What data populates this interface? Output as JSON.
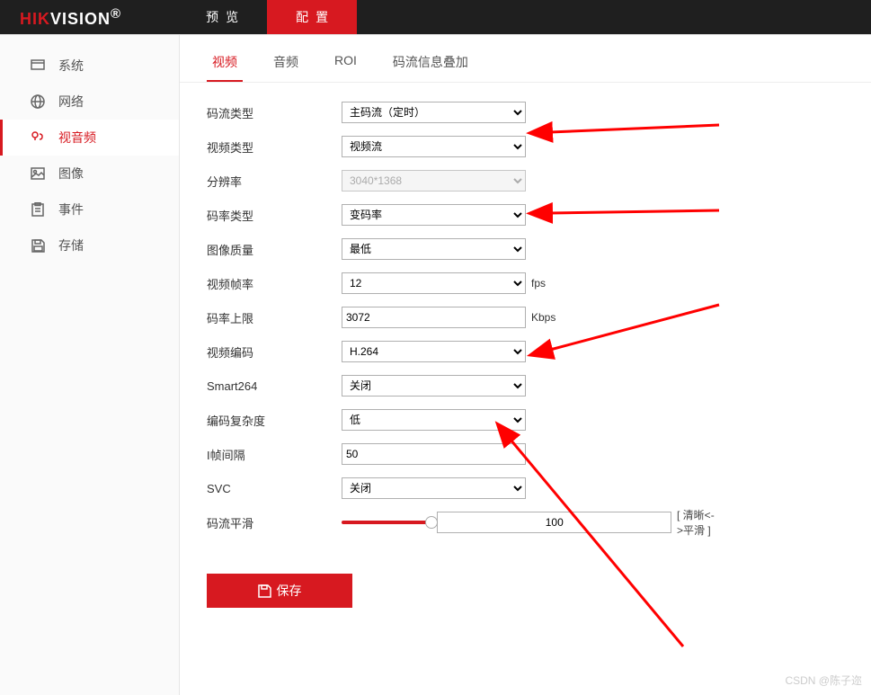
{
  "logo": {
    "brand1": "HIK",
    "brand2": "VISION",
    "reg": "®"
  },
  "topTabs": {
    "preview": "预览",
    "config": "配置"
  },
  "sidebar": {
    "system": "系统",
    "network": "网络",
    "video_audio": "视音频",
    "image": "图像",
    "event": "事件",
    "storage": "存储"
  },
  "subTabs": {
    "video": "视频",
    "audio": "音频",
    "roi": "ROI",
    "overlay": "码流信息叠加"
  },
  "form": {
    "stream_type": {
      "label": "码流类型",
      "value": "主码流（定时）"
    },
    "video_type": {
      "label": "视频类型",
      "value": "视频流"
    },
    "resolution": {
      "label": "分辨率",
      "value": "3040*1368"
    },
    "bitrate_type": {
      "label": "码率类型",
      "value": "变码率"
    },
    "image_quality": {
      "label": "图像质量",
      "value": "最低"
    },
    "frame_rate": {
      "label": "视频帧率",
      "value": "12",
      "unit": "fps"
    },
    "bitrate_max": {
      "label": "码率上限",
      "value": "3072",
      "unit": "Kbps"
    },
    "video_codec": {
      "label": "视频编码",
      "value": "H.264"
    },
    "smart264": {
      "label": "Smart264",
      "value": "关闭"
    },
    "complexity": {
      "label": "编码复杂度",
      "value": "低"
    },
    "iframe": {
      "label": "I帧间隔",
      "value": "50"
    },
    "svc": {
      "label": "SVC",
      "value": "关闭"
    },
    "smoothing": {
      "label": "码流平滑",
      "value": "100",
      "hint": "[ 清晰<->平滑 ]"
    }
  },
  "buttons": {
    "save": "保存"
  },
  "watermark": "CSDN @陈子迩"
}
